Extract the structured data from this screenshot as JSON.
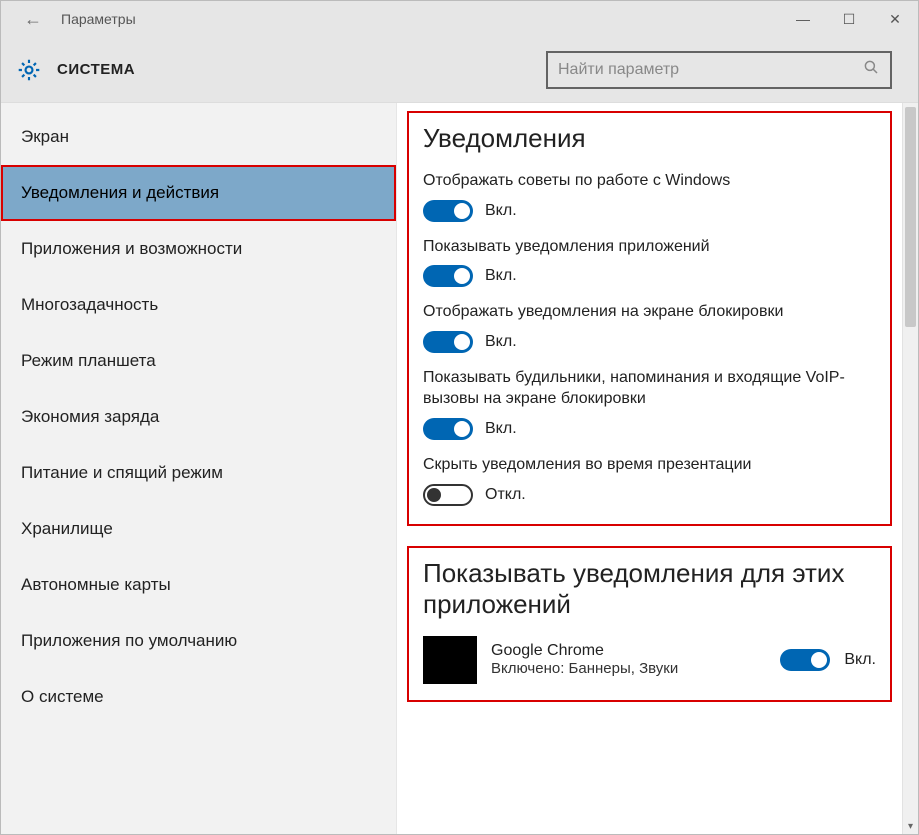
{
  "titlebar": {
    "back_glyph": "←",
    "title": "Параметры",
    "minimize": "—",
    "maximize": "☐",
    "close": "✕"
  },
  "header": {
    "section_title": "СИСТЕМА",
    "search_placeholder": "Найти параметр"
  },
  "sidebar": {
    "items": [
      {
        "label": "Экран",
        "selected": false
      },
      {
        "label": "Уведомления и действия",
        "selected": true
      },
      {
        "label": "Приложения и возможности",
        "selected": false
      },
      {
        "label": "Многозадачность",
        "selected": false
      },
      {
        "label": "Режим планшета",
        "selected": false
      },
      {
        "label": "Экономия заряда",
        "selected": false
      },
      {
        "label": "Питание и спящий режим",
        "selected": false
      },
      {
        "label": "Хранилище",
        "selected": false
      },
      {
        "label": "Автономные карты",
        "selected": false
      },
      {
        "label": "Приложения по умолчанию",
        "selected": false
      },
      {
        "label": "О системе",
        "selected": false
      }
    ]
  },
  "main": {
    "notifications": {
      "heading": "Уведомления",
      "options": [
        {
          "label": "Отображать советы по работе с Windows",
          "on": true,
          "on_text": "Вкл."
        },
        {
          "label": "Показывать уведомления приложений",
          "on": true,
          "on_text": "Вкл."
        },
        {
          "label": "Отображать уведомления на экране блокировки",
          "on": true,
          "on_text": "Вкл."
        },
        {
          "label": "Показывать будильники, напоминания и входящие VoIP-вызовы на экране блокировки",
          "on": true,
          "on_text": "Вкл."
        },
        {
          "label": "Скрыть уведомления во время презентации",
          "on": false,
          "on_text": "Откл."
        }
      ]
    },
    "apps": {
      "heading": "Показывать уведомления для этих приложений",
      "list": [
        {
          "name": "Google Chrome",
          "sub": "Включено: Баннеры, Звуки",
          "on": true,
          "on_text": "Вкл."
        }
      ]
    }
  }
}
